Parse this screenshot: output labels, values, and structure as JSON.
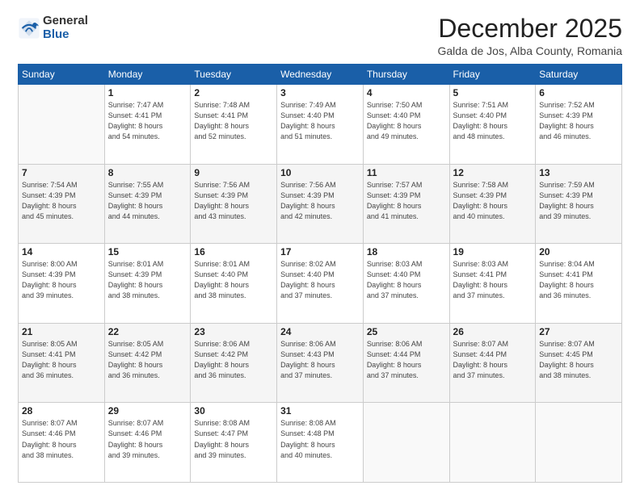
{
  "logo": {
    "general": "General",
    "blue": "Blue"
  },
  "header": {
    "month": "December 2025",
    "location": "Galda de Jos, Alba County, Romania"
  },
  "weekdays": [
    "Sunday",
    "Monday",
    "Tuesday",
    "Wednesday",
    "Thursday",
    "Friday",
    "Saturday"
  ],
  "weeks": [
    [
      {
        "day": "",
        "info": ""
      },
      {
        "day": "1",
        "info": "Sunrise: 7:47 AM\nSunset: 4:41 PM\nDaylight: 8 hours\nand 54 minutes."
      },
      {
        "day": "2",
        "info": "Sunrise: 7:48 AM\nSunset: 4:41 PM\nDaylight: 8 hours\nand 52 minutes."
      },
      {
        "day": "3",
        "info": "Sunrise: 7:49 AM\nSunset: 4:40 PM\nDaylight: 8 hours\nand 51 minutes."
      },
      {
        "day": "4",
        "info": "Sunrise: 7:50 AM\nSunset: 4:40 PM\nDaylight: 8 hours\nand 49 minutes."
      },
      {
        "day": "5",
        "info": "Sunrise: 7:51 AM\nSunset: 4:40 PM\nDaylight: 8 hours\nand 48 minutes."
      },
      {
        "day": "6",
        "info": "Sunrise: 7:52 AM\nSunset: 4:39 PM\nDaylight: 8 hours\nand 46 minutes."
      }
    ],
    [
      {
        "day": "7",
        "info": "Sunrise: 7:54 AM\nSunset: 4:39 PM\nDaylight: 8 hours\nand 45 minutes."
      },
      {
        "day": "8",
        "info": "Sunrise: 7:55 AM\nSunset: 4:39 PM\nDaylight: 8 hours\nand 44 minutes."
      },
      {
        "day": "9",
        "info": "Sunrise: 7:56 AM\nSunset: 4:39 PM\nDaylight: 8 hours\nand 43 minutes."
      },
      {
        "day": "10",
        "info": "Sunrise: 7:56 AM\nSunset: 4:39 PM\nDaylight: 8 hours\nand 42 minutes."
      },
      {
        "day": "11",
        "info": "Sunrise: 7:57 AM\nSunset: 4:39 PM\nDaylight: 8 hours\nand 41 minutes."
      },
      {
        "day": "12",
        "info": "Sunrise: 7:58 AM\nSunset: 4:39 PM\nDaylight: 8 hours\nand 40 minutes."
      },
      {
        "day": "13",
        "info": "Sunrise: 7:59 AM\nSunset: 4:39 PM\nDaylight: 8 hours\nand 39 minutes."
      }
    ],
    [
      {
        "day": "14",
        "info": "Sunrise: 8:00 AM\nSunset: 4:39 PM\nDaylight: 8 hours\nand 39 minutes."
      },
      {
        "day": "15",
        "info": "Sunrise: 8:01 AM\nSunset: 4:39 PM\nDaylight: 8 hours\nand 38 minutes."
      },
      {
        "day": "16",
        "info": "Sunrise: 8:01 AM\nSunset: 4:40 PM\nDaylight: 8 hours\nand 38 minutes."
      },
      {
        "day": "17",
        "info": "Sunrise: 8:02 AM\nSunset: 4:40 PM\nDaylight: 8 hours\nand 37 minutes."
      },
      {
        "day": "18",
        "info": "Sunrise: 8:03 AM\nSunset: 4:40 PM\nDaylight: 8 hours\nand 37 minutes."
      },
      {
        "day": "19",
        "info": "Sunrise: 8:03 AM\nSunset: 4:41 PM\nDaylight: 8 hours\nand 37 minutes."
      },
      {
        "day": "20",
        "info": "Sunrise: 8:04 AM\nSunset: 4:41 PM\nDaylight: 8 hours\nand 36 minutes."
      }
    ],
    [
      {
        "day": "21",
        "info": "Sunrise: 8:05 AM\nSunset: 4:41 PM\nDaylight: 8 hours\nand 36 minutes."
      },
      {
        "day": "22",
        "info": "Sunrise: 8:05 AM\nSunset: 4:42 PM\nDaylight: 8 hours\nand 36 minutes."
      },
      {
        "day": "23",
        "info": "Sunrise: 8:06 AM\nSunset: 4:42 PM\nDaylight: 8 hours\nand 36 minutes."
      },
      {
        "day": "24",
        "info": "Sunrise: 8:06 AM\nSunset: 4:43 PM\nDaylight: 8 hours\nand 37 minutes."
      },
      {
        "day": "25",
        "info": "Sunrise: 8:06 AM\nSunset: 4:44 PM\nDaylight: 8 hours\nand 37 minutes."
      },
      {
        "day": "26",
        "info": "Sunrise: 8:07 AM\nSunset: 4:44 PM\nDaylight: 8 hours\nand 37 minutes."
      },
      {
        "day": "27",
        "info": "Sunrise: 8:07 AM\nSunset: 4:45 PM\nDaylight: 8 hours\nand 38 minutes."
      }
    ],
    [
      {
        "day": "28",
        "info": "Sunrise: 8:07 AM\nSunset: 4:46 PM\nDaylight: 8 hours\nand 38 minutes."
      },
      {
        "day": "29",
        "info": "Sunrise: 8:07 AM\nSunset: 4:46 PM\nDaylight: 8 hours\nand 39 minutes."
      },
      {
        "day": "30",
        "info": "Sunrise: 8:08 AM\nSunset: 4:47 PM\nDaylight: 8 hours\nand 39 minutes."
      },
      {
        "day": "31",
        "info": "Sunrise: 8:08 AM\nSunset: 4:48 PM\nDaylight: 8 hours\nand 40 minutes."
      },
      {
        "day": "",
        "info": ""
      },
      {
        "day": "",
        "info": ""
      },
      {
        "day": "",
        "info": ""
      }
    ]
  ]
}
